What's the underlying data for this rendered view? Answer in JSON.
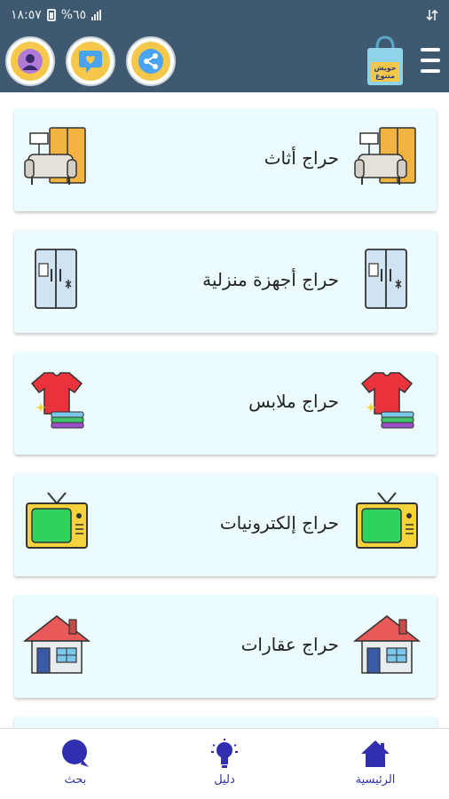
{
  "status_bar": {
    "time": "١٨:٥٧",
    "battery": "%٦٥"
  },
  "toolbar": {
    "logo_text": "حويش متنوع",
    "buttons": [
      {
        "name": "profile",
        "icon": "person-icon"
      },
      {
        "name": "chat",
        "icon": "heart-message-icon"
      },
      {
        "name": "share",
        "icon": "share-icon"
      }
    ]
  },
  "categories": [
    {
      "label": "حراج أثاث",
      "icon": "furniture-icon"
    },
    {
      "label": "حراج أجهزة منزلية",
      "icon": "refrigerator-icon"
    },
    {
      "label": "حراج ملابس",
      "icon": "clothes-icon"
    },
    {
      "label": "حراج إلكترونيات",
      "icon": "tv-icon"
    },
    {
      "label": "حراج عقارات",
      "icon": "house-icon"
    }
  ],
  "bottom_nav": {
    "home": "الرئيسية",
    "guide": "دليل",
    "search": "بحث",
    "accent_color": "#2f2fb0"
  },
  "colors": {
    "header": "#3f5a70",
    "card_bg": "#ecfbfd",
    "button_yellow": "#f5c74a"
  }
}
